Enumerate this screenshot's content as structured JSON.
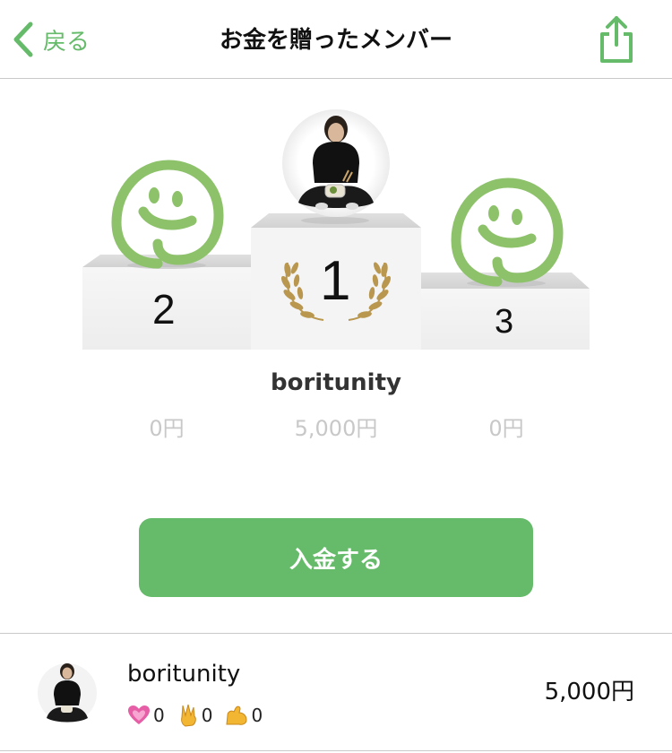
{
  "header": {
    "back_label": "戻る",
    "title": "お金を贈ったメンバー"
  },
  "podium": {
    "first": {
      "rank": "1",
      "name": "boritunity",
      "amount": "5,000円"
    },
    "second": {
      "rank": "2",
      "amount": "0円"
    },
    "third": {
      "rank": "3",
      "amount": "0円"
    }
  },
  "deposit_button": {
    "label": "入金する"
  },
  "members": [
    {
      "name": "boritunity",
      "amount": "5,000円",
      "reactions": [
        {
          "icon": "heart-icon",
          "count": "0"
        },
        {
          "icon": "peace-hand-icon",
          "count": "0"
        },
        {
          "icon": "flexed-arm-icon",
          "count": "0"
        }
      ]
    }
  ],
  "colors": {
    "accent": "#66bb6a",
    "mascot": "#8dc26b",
    "laurel": "#b9974f"
  }
}
